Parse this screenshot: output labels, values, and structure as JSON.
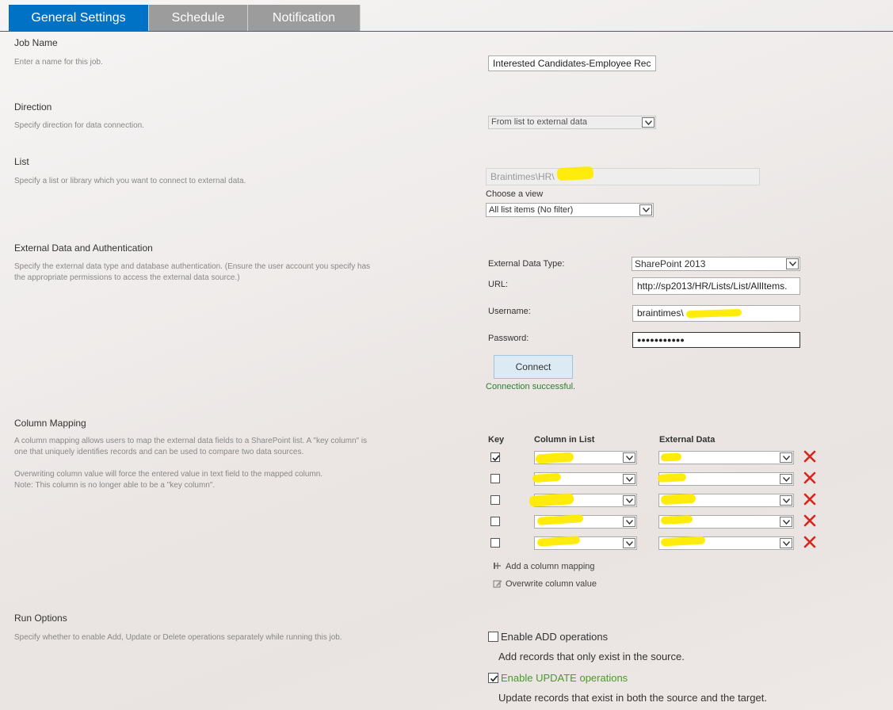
{
  "tabs": [
    {
      "label": "General Settings",
      "active": true
    },
    {
      "label": "Schedule",
      "active": false
    },
    {
      "label": "Notification",
      "active": false
    }
  ],
  "job_name": {
    "title": "Job Name",
    "desc": "Enter a name for this job.",
    "value": "Interested Candidates-Employee Rec"
  },
  "direction": {
    "title": "Direction",
    "desc": "Specify direction for data connection.",
    "value": "From list to external data"
  },
  "list": {
    "title": "List",
    "desc": "Specify a list or library which you want to connect to external data.",
    "value": "Braintimes\\HR\\",
    "choose_view_label": "Choose a view",
    "view_value": "All list items (No filter)"
  },
  "external": {
    "title": "External Data and Authentication",
    "desc1": "Specify the external data type and database authentication. (Ensure the user account you specify has",
    "desc2": "the appropriate permissions to access the external data source.)",
    "type_label": "External Data Type:",
    "type_value": "SharePoint 2013",
    "url_label": "URL:",
    "url_value": "http://sp2013/HR/Lists/List/AllItems.",
    "username_label": "Username:",
    "username_value": "braintimes\\",
    "password_label": "Password:",
    "password_value": "●●●●●●●●●●●",
    "connect_label": "Connect",
    "status": "Connection successful."
  },
  "mapping": {
    "title": "Column Mapping",
    "desc1": "A column mapping allows users to map the external data fields to a SharePoint list. A \"key column\" is",
    "desc2": "one that uniquely identifies records and can be used to compare two data sources.",
    "desc3": "Overwriting column value will force the entered value in text field to the mapped column.",
    "desc4": "Note: This column is no longer able to be a \"key column\".",
    "header_key": "Key",
    "header_list": "Column in List",
    "header_external": "External Data",
    "rows": [
      {
        "key": true
      },
      {
        "key": false
      },
      {
        "key": false
      },
      {
        "key": false
      },
      {
        "key": false
      }
    ],
    "add_label": "Add a column mapping",
    "overwrite_label": "Overwrite column value"
  },
  "run": {
    "title": "Run Options",
    "desc": "Specify whether to enable Add, Update or Delete operations separately while running this job.",
    "add_label": "Enable ADD operations",
    "add_checked": false,
    "add_desc": "Add records that only exist in the source.",
    "update_label": "Enable UPDATE operations",
    "update_checked": true,
    "update_desc": "Update records that exist in both the source and the target."
  },
  "colors": {
    "accent": "#0072c6",
    "tab_inactive": "#9c9c9c",
    "success": "#2e7d32",
    "delete": "#d9261c"
  },
  "icons": [
    "chevron-down-icon",
    "checkmark-icon",
    "delete-x-icon",
    "add-mapping-icon",
    "edit-pencil-icon"
  ]
}
